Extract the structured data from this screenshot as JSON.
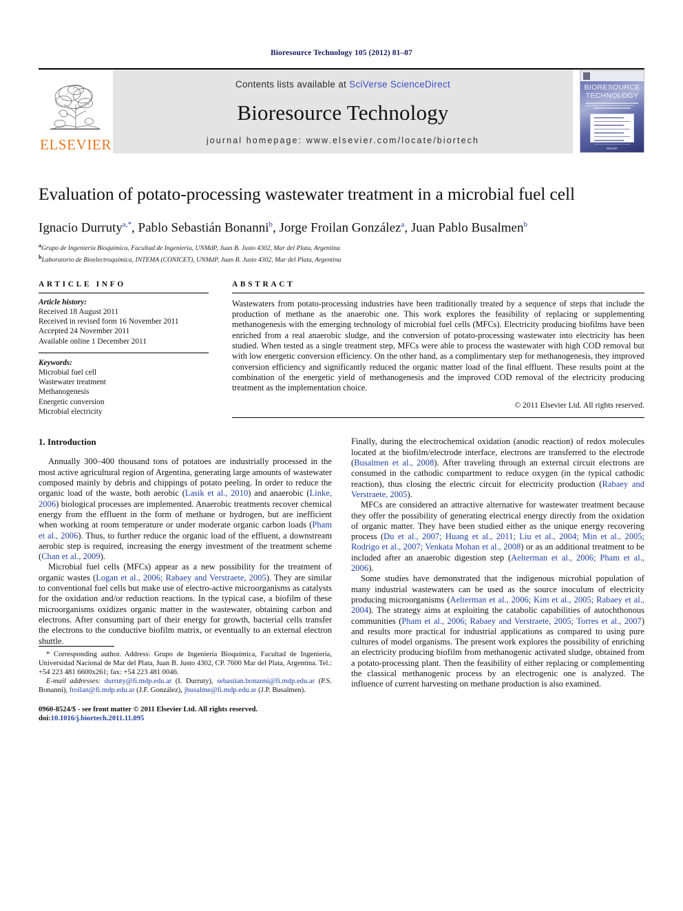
{
  "running_head": "Bioresource Technology 105 (2012) 81–87",
  "masthead": {
    "publisher_name": "ELSEVIER",
    "contents_prefix": "Contents lists available at ",
    "contents_link": "SciVerse ScienceDirect",
    "journal_name": "Bioresource Technology",
    "homepage": "journal homepage: www.elsevier.com/locate/biortech",
    "cover_title_line1": "BIORESOURCE",
    "cover_title_line2": "TECHNOLOGY",
    "cover_footer": "Elsevier"
  },
  "article": {
    "title": "Evaluation of potato-processing wastewater treatment in a microbial fuel cell",
    "authors_html": "Ignacio Durruty <sup>a,*</sup>, Pablo Sebastián Bonanni <sup>b</sup>, Jorge Froilan González <sup>a</sup>, Juan Pablo Busalmen <sup>b</sup>",
    "affiliation_a": "Grupo de Ingeniería Bioquímica, Facultad de Ingeniería, UNMdP, Juan B. Justo 4302, Mar del Plata, Argentina",
    "affiliation_b": "Laboratorio de Bioelectroquímica, INTEMA (CONICET), UNMdP, Juan B. Justo 4302, Mar del Plata, Argentina",
    "affil_marker_a": "a",
    "affil_marker_b": "b"
  },
  "article_info": {
    "heading": "ARTICLE INFO",
    "history_label": "Article history:",
    "history": [
      "Received 18 August 2011",
      "Received in revised form 16 November 2011",
      "Accepted 24 November 2011",
      "Available online 1 December 2011"
    ],
    "keywords_label": "Keywords:",
    "keywords": [
      "Microbial fuel cell",
      "Wastewater treatment",
      "Methanogenesis",
      "Energetic conversion",
      "Microbial electricity"
    ]
  },
  "abstract": {
    "heading": "ABSTRACT",
    "text": "Wastewaters from potato-processing industries have been traditionally treated by a sequence of steps that include the production of methane as the anaerobic one. This work explores the feasibility of replacing or supplementing methanogenesis with the emerging technology of microbial fuel cells (MFCs). Electricity producing biofilms have been enriched from a real anaerobic sludge, and the conversion of potato-processing wastewater into electricity has been studied. When tested as a single treatment step, MFCs were able to process the wastewater with high COD removal but with low energetic conversion efficiency. On the other hand, as a complimentary step for methanogenesis, they improved conversion efficiency and significantly reduced the organic matter load of the final effluent. These results point at the combination of the energetic yield of methanogenesis and the improved COD removal of the electricity producing treatment as the implementation choice.",
    "copyright": "© 2011 Elsevier Ltd. All rights reserved."
  },
  "body": {
    "section_heading": "1. Introduction",
    "left_paragraphs": [
      "Annually 300–400 thousand tons of potatoes are industrially processed in the most active agricultural region of Argentina, generating large amounts of wastewater composed mainly by debris and chippings of potato peeling. In order to reduce the organic load of the waste, both aerobic (Lasik et al., 2010) and anaerobic (Linke, 2006) biological processes are implemented. Anaerobic treatments recover chemical energy from the effluent in the form of methane or hydrogen, but are inefficient when working at room temperature or under moderate organic carbon loads (Pham et al., 2006). Thus, to further reduce the organic load of the effluent, a downstream aerobic step is required, increasing the energy investment of the treatment scheme (Chan et al., 2009).",
      "Microbial fuel cells (MFCs) appear as a new possibility for the treatment of organic wastes (Logan et al., 2006; Rabaey and Verstraete, 2005). They are similar to conventional fuel cells but make use of electro-active microorganisms as catalysts for the oxidation and/or reduction reactions. In the typical case, a biofilm of these microorganisms oxidizes organic matter in the wastewater, obtaining carbon and electrons. After consuming part of their energy for growth, bacterial cells transfer the electrons to the conductive biofilm matrix, or eventually to an external electron shuttle."
    ],
    "right_paragraphs": [
      "Finally, during the electrochemical oxidation (anodic reaction) of redox molecules located at the biofilm/electrode interface, electrons are transferred to the electrode (Busalmen et al., 2008). After traveling through an external circuit electrons are consumed in the cathodic compartment to reduce oxygen (in the typical cathodic reaction), thus closing the electric circuit for electricity production (Rabaey and Verstraete, 2005).",
      "MFCs are considered an attractive alternative for wastewater treatment because they offer the possibility of generating electrical energy directly from the oxidation of organic matter. They have been studied either as the unique energy recovering process (Du et al., 2007; Huang et al., 2011; Liu et al., 2004; Min et al., 2005; Rodrigo et al., 2007; Venkata Mohan et al., 2008) or as an additional treatment to be included after an anaerobic digestion step (Aelterman et al., 2006; Pham et al., 2006).",
      "Some studies have demonstrated that the indigenous microbial population of many industrial wastewaters can be used as the source inoculum of electricity producing microorganisms (Aelterman et al., 2006; Kim et al., 2005; Rabaey et al., 2004). The strategy aims at exploiting the catabolic capabilities of autochthonous communities (Pham et al., 2006; Rabaey and Verstraete, 2005; Torres et al., 2007) and results more practical for industrial applications as compared to using pure cultures of model organisms. The present work explores the possibility of enriching an electricity producing biofilm from methanogenic activated sludge, obtained from a potato-processing plant. Then the feasibility of either replacing or complementing the classical methanogenic process by an electrogenic one is analyzed. The influence of current harvesting on methane production is also examined."
    ]
  },
  "footnotes": {
    "corresponding": "* Corresponding author. Address: Grupo de Ingeniería Bioquímica, Facultad de Ingeniería, Universidad Nacional de Mar del Plata, Juan B. Justo 4302, CP. 7600 Mar del Plata, Argentina. Tel.: +54 223 481 6600x261; fax: +54 223 481 0046.",
    "email_label": "E-mail addresses:",
    "emails": [
      {
        "addr": "durruty@fi.mdp.edu.ar",
        "who": "(I. Durruty),"
      },
      {
        "addr": "sebastian.bonanni@fi.mdp.edu.ar",
        "who": "(P.S. Bonanni),"
      },
      {
        "addr": "froilan@fi.mdp.edu.ar",
        "who": "(J.F. González),"
      },
      {
        "addr": "jbusalme@fi.mdp.edu.ar",
        "who": "(J.P. Busalmen)."
      }
    ],
    "issn_line": "0960-8524/$ - see front matter © 2011 Elsevier Ltd. All rights reserved.",
    "doi_prefix": "doi:",
    "doi": "10.1016/j.biortech.2011.11.095"
  },
  "colors": {
    "link": "#1f3fa0",
    "sciencedirect": "#3b4ec4",
    "elsevier_orange": "#E87722",
    "masthead_band": "#e4e4e4"
  }
}
